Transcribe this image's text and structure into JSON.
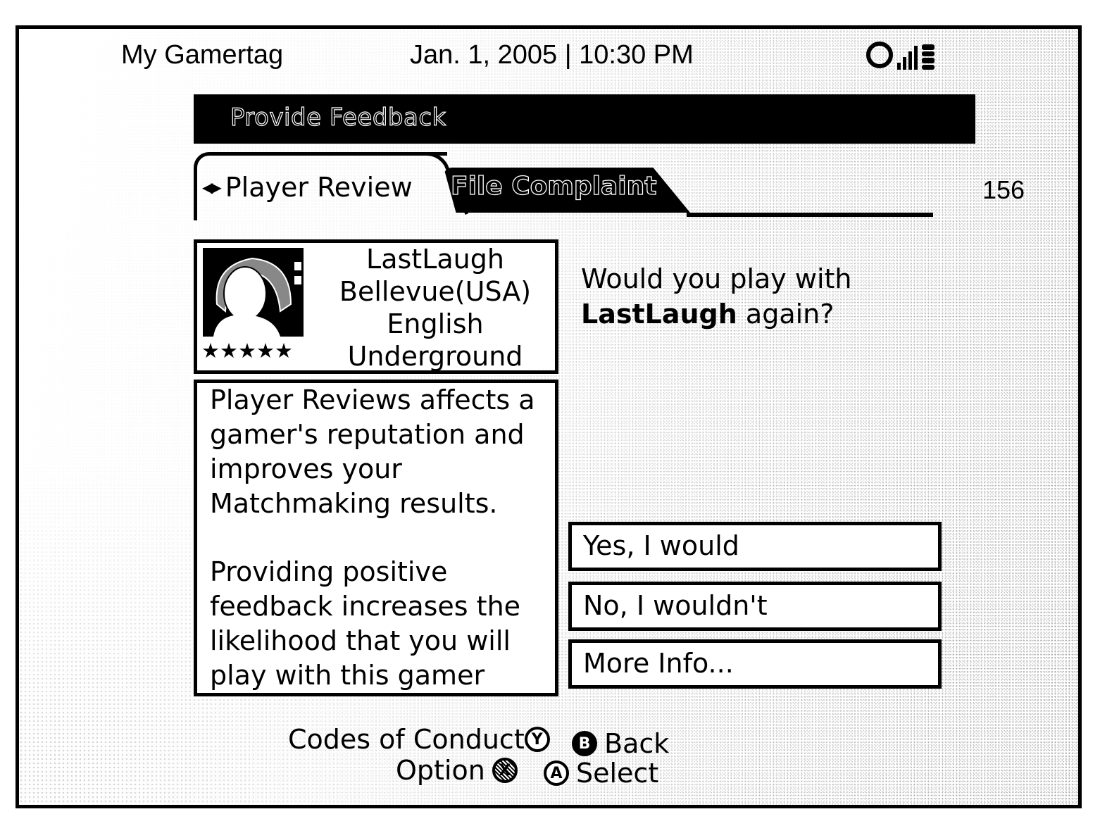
{
  "status_bar": {
    "gamertag": "My Gamertag",
    "datetime": "Jan. 1, 2005 | 10:30 PM",
    "icons": [
      "controller-ring-icon",
      "signal-bars-icon",
      "battery-icon"
    ]
  },
  "title": "Provide Feedback",
  "tabs": [
    {
      "label": "Player Review",
      "active": true,
      "icon": "left-right-arrows-icon"
    },
    {
      "label": "File Complaint",
      "active": false
    }
  ],
  "count": "156",
  "profile": {
    "gamertag": "LastLaugh",
    "location": "Bellevue(USA)",
    "language": "English",
    "zone": "Underground",
    "rating_stars": 5,
    "rating_max": 5
  },
  "description": {
    "paragraph1": "Player Reviews affects a gamer's reputation and improves your Matchmaking results.",
    "paragraph2": "Providing positive feedback increases the likelihood that you will play with this gamer"
  },
  "question": {
    "prefix": "Would you play with",
    "gamertag": "LastLaugh",
    "suffix": "again?"
  },
  "options": [
    {
      "label": "Yes, I would"
    },
    {
      "label": "No, I wouldn't"
    },
    {
      "label": "More Info..."
    }
  ],
  "footer": {
    "codes_of_conduct": {
      "label": "Codes of Conduct",
      "button": "Y"
    },
    "back": {
      "label": "Back",
      "button": "B"
    },
    "option": {
      "label": "Option",
      "button": "X"
    },
    "select": {
      "label": "Select",
      "button": "A"
    }
  }
}
